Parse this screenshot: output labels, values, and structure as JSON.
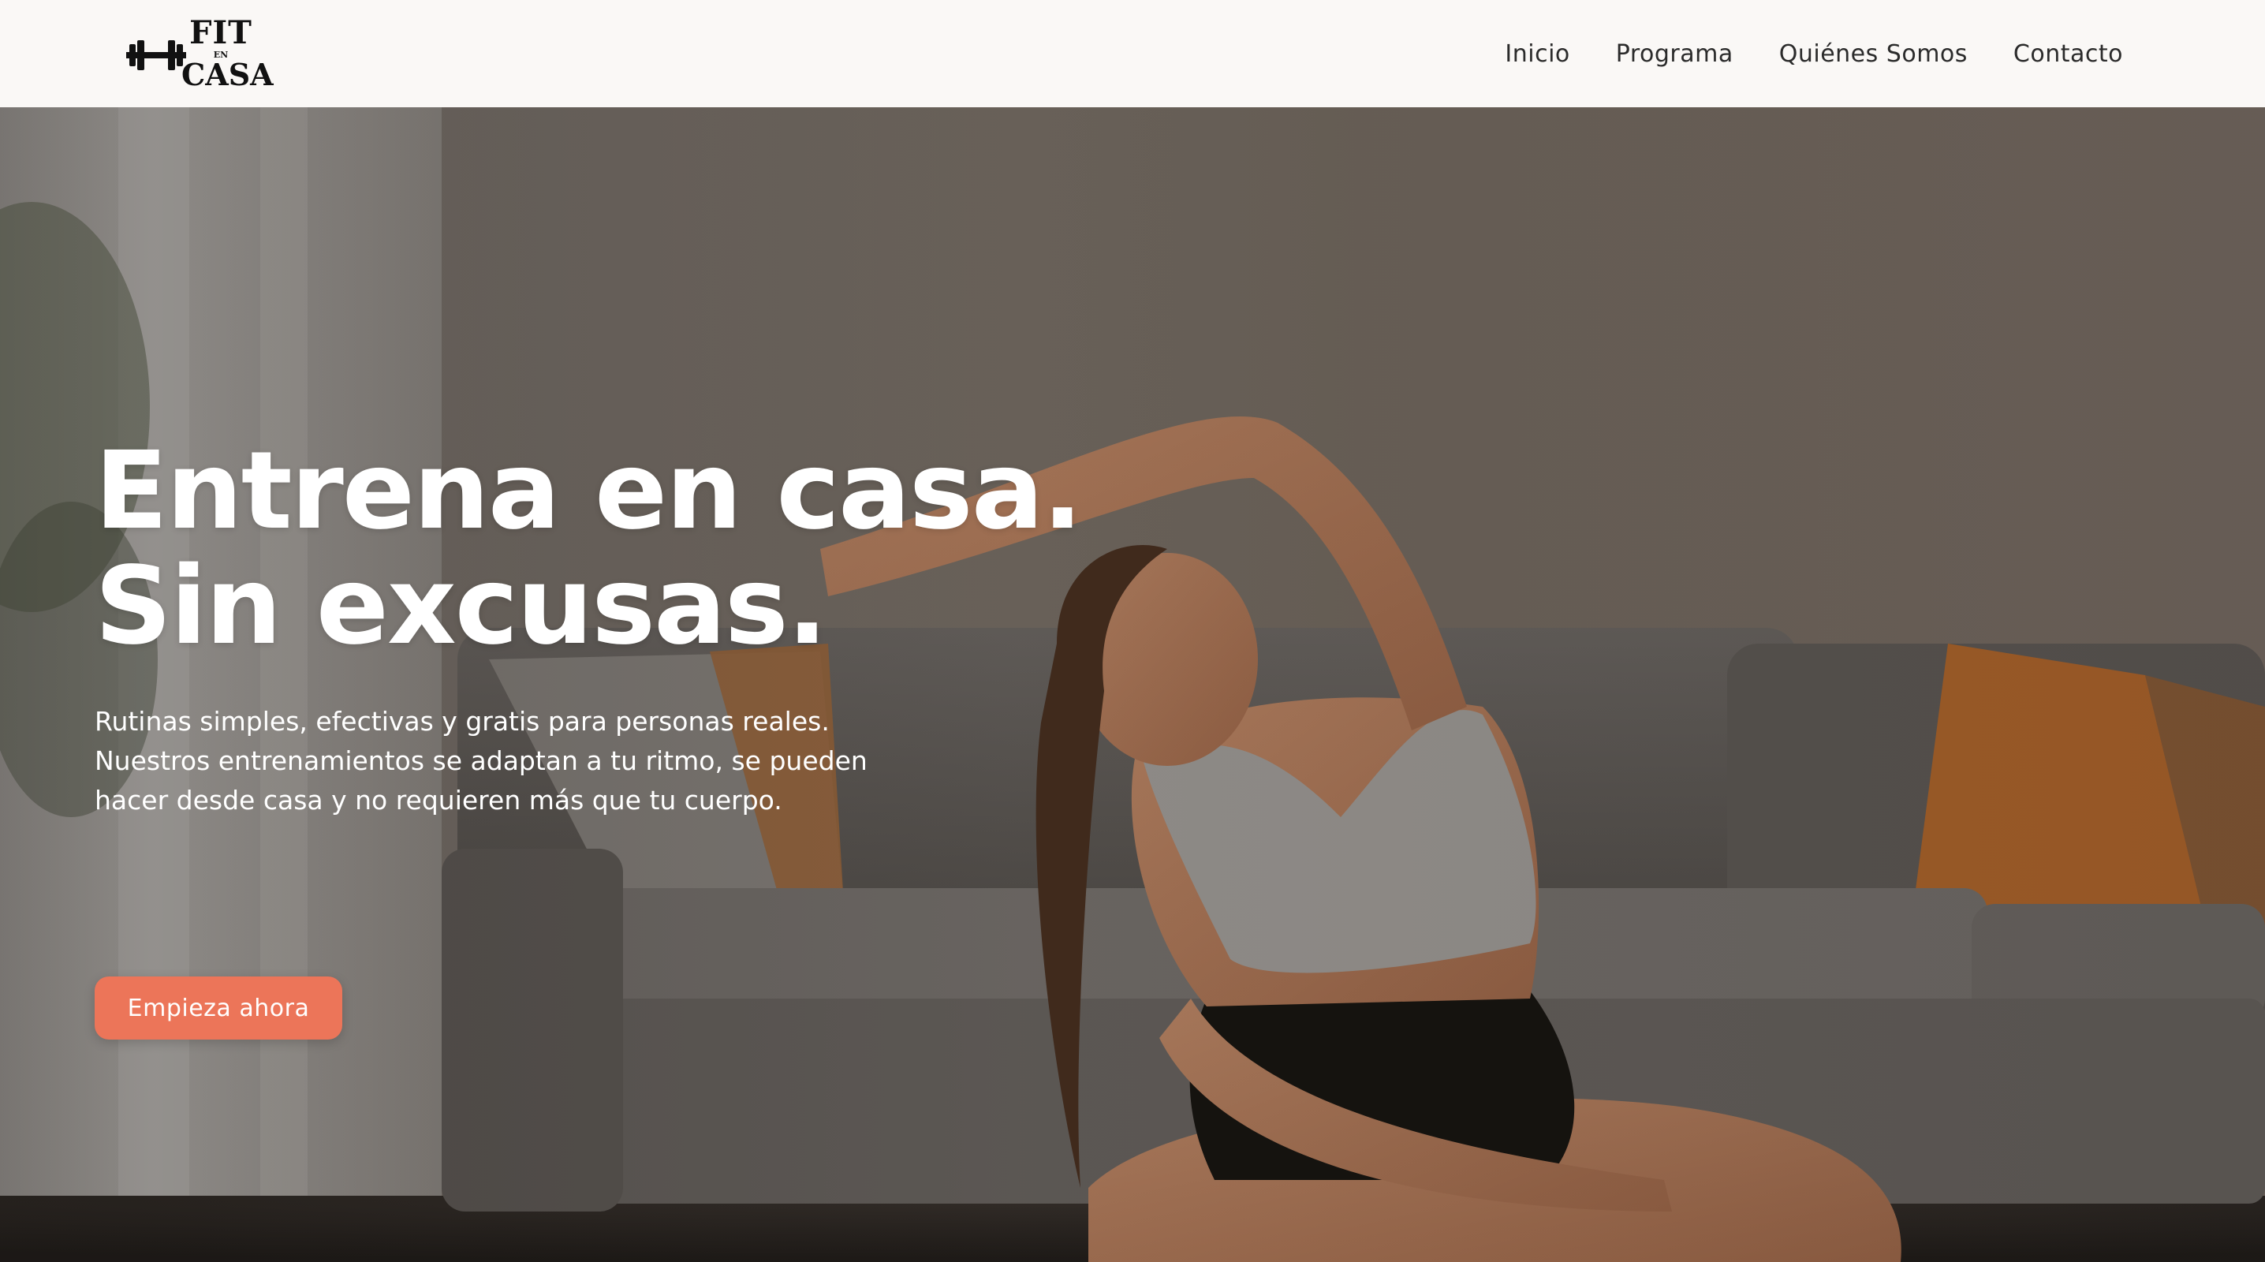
{
  "nav": {
    "logo": {
      "line1": "FIT",
      "line2": "EN",
      "line3": "CASA",
      "icon": "dumbbell-icon"
    },
    "links": [
      {
        "label": "Inicio"
      },
      {
        "label": "Programa"
      },
      {
        "label": "Quiénes Somos"
      },
      {
        "label": "Contacto"
      }
    ]
  },
  "hero": {
    "title_line1": "Entrena en casa.",
    "title_line2": "Sin excusas.",
    "desc_line1": "Rutinas simples, efectivas y gratis para personas reales.",
    "desc_line2": "Nuestros entrenamientos se adaptan a tu ritmo, se pueden",
    "desc_line3": "hacer desde casa y no requieren más que tu cuerpo.",
    "cta_label": "Empieza ahora"
  },
  "colors": {
    "nav_bg": "#faf8f6",
    "accent": "#ec7559",
    "hero_text": "#ffffff"
  }
}
